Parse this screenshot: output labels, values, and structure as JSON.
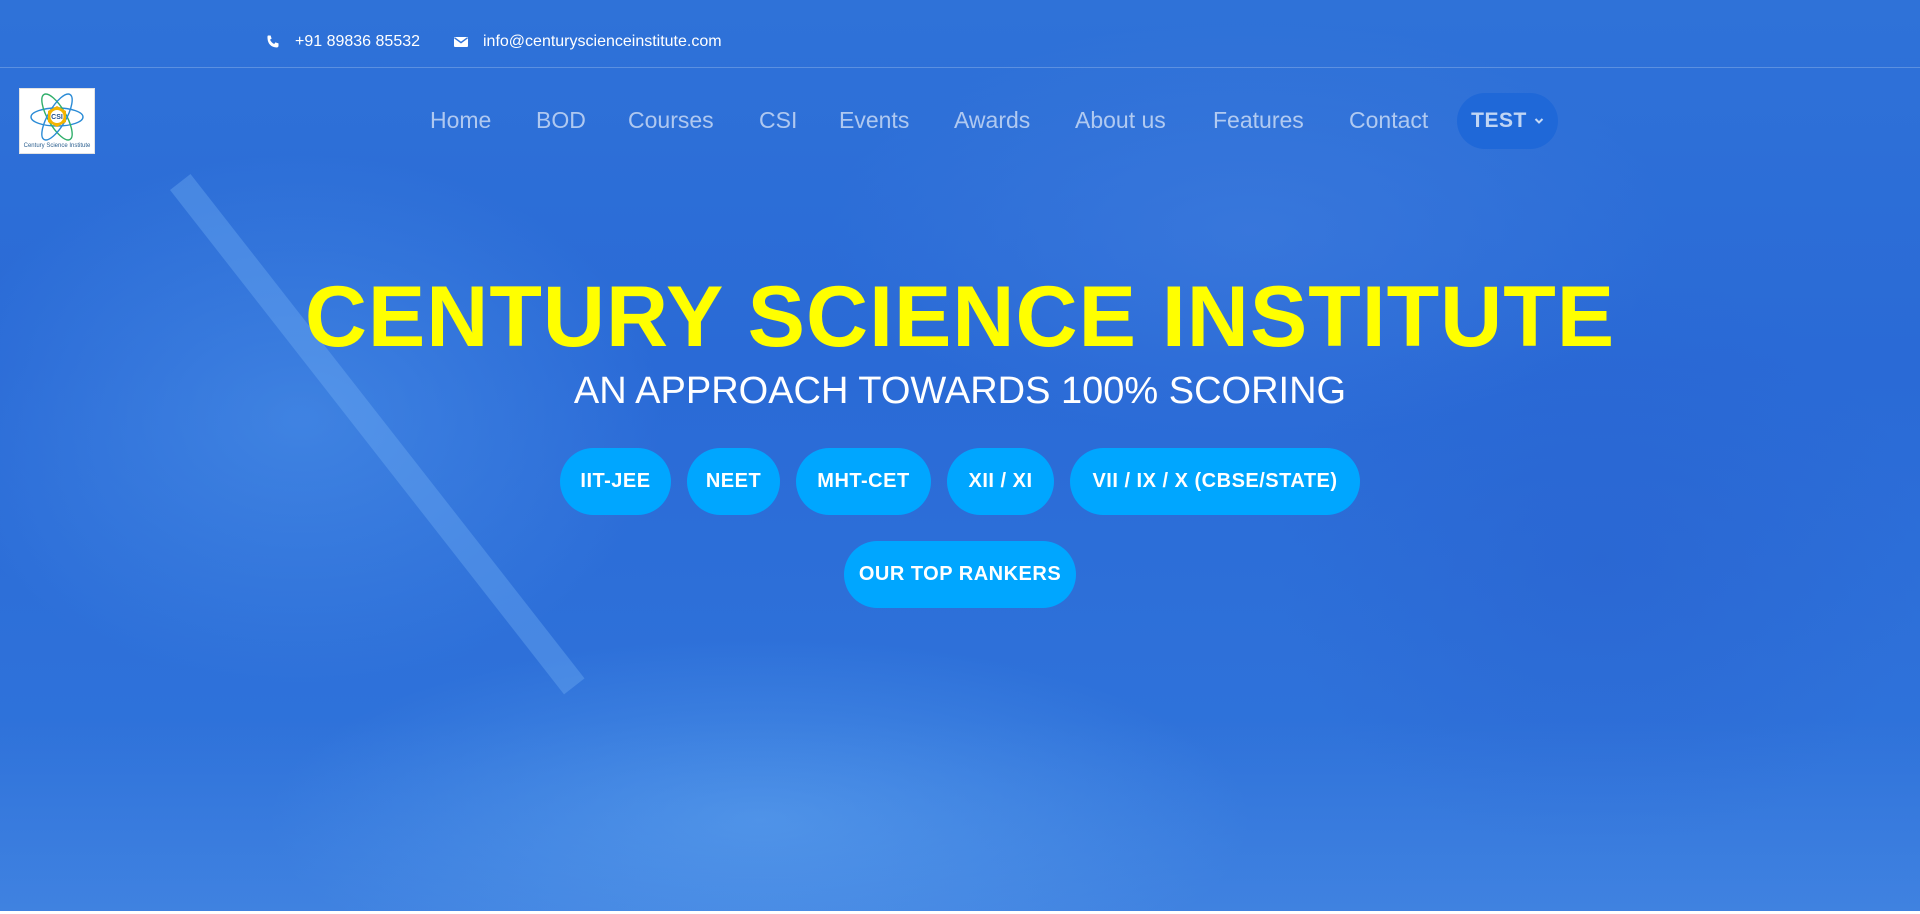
{
  "contact": {
    "phone": "+91 89836 85532",
    "email": "info@centuryscienceinstitute.com"
  },
  "logo": {
    "initials": "CSI",
    "caption": "Century Science Institute"
  },
  "nav": {
    "items": [
      "Home",
      "BOD",
      "Courses",
      "CSI",
      "Events",
      "Awards",
      "About us",
      "Features",
      "Contact"
    ],
    "dropdown_label": "TEST"
  },
  "hero": {
    "title": "CENTURY SCIENCE INSTITUTE",
    "subtitle": "AN APPROACH TOWARDS 100% SCORING",
    "courses": [
      "IIT-JEE",
      "NEET",
      "MHT-CET",
      "XII / XI",
      "VII / IX / X (CBSE/STATE)"
    ],
    "rankers_label": "OUR TOP RANKERS"
  },
  "colors": {
    "title": "#ffff00",
    "button": "#00a6ff",
    "background": "#2f72d8"
  }
}
